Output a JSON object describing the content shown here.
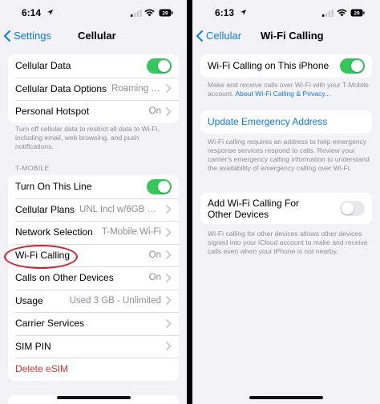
{
  "left": {
    "status": {
      "time": "6:14",
      "battery": "29"
    },
    "nav": {
      "back_label": "Settings",
      "title": "Cellular"
    },
    "group1": [
      {
        "label": "Cellular Data",
        "toggle": "on"
      },
      {
        "label": "Cellular Data Options",
        "value": "Roaming On"
      },
      {
        "label": "Personal Hotspot",
        "value": "On"
      }
    ],
    "footnote1": "Turn off cellular data to restrict all data to Wi-Fi, including email, web browsing, and push notifications.",
    "section_header": "T-MOBILE",
    "group2": [
      {
        "label": "Turn On This Line",
        "toggle": "on"
      },
      {
        "label": "Cellular Plans",
        "value": "UNL Incl w/6GB SM..."
      },
      {
        "label": "Network Selection",
        "value": "T-Mobile Wi-Fi"
      },
      {
        "label": "Wi-Fi Calling",
        "value": "On"
      },
      {
        "label": "Calls on Other Devices",
        "value": "On"
      },
      {
        "label": "Usage",
        "value": "Used 3 GB - Unlimited"
      },
      {
        "label": "Carrier Services",
        "value": ""
      },
      {
        "label": "SIM PIN",
        "value": ""
      },
      {
        "label": "Delete eSIM",
        "value": ""
      }
    ]
  },
  "right": {
    "status": {
      "time": "6:13",
      "battery": "29"
    },
    "nav": {
      "back_label": "Cellular",
      "title": "Wi-Fi Calling"
    },
    "wifi_calling_row": {
      "label": "Wi-Fi Calling on This iPhone",
      "toggle": "on"
    },
    "footnote1_text": "Make and receive calls over Wi-Fi with your T-Mobile account. ",
    "footnote1_link": "About Wi-Fi Calling & Privacy...",
    "update_address": "Update Emergency Address",
    "footnote2": "Wi-Fi calling requires an address to help emergency response services respond to calls. Review your carrier's emergency calling information to understand the availability of emergency calling over Wi-Fi.",
    "add_row": {
      "label": "Add Wi-Fi Calling For Other Devices",
      "toggle": "off"
    },
    "footnote3": "Wi-Fi calling for other devices allows other devices signed into your iCloud account to make and receive calls even when your iPhone is not nearby."
  },
  "colors": {
    "accent": "#0a7aff",
    "toggle_on": "#34c759",
    "danger": "#e0322f",
    "annotation": "#d81e2a"
  },
  "icons": [
    "location-arrow-icon",
    "cellular-signal-icon",
    "wifi-icon",
    "battery-icon",
    "back-chevron-icon",
    "chevron-right-icon"
  ]
}
